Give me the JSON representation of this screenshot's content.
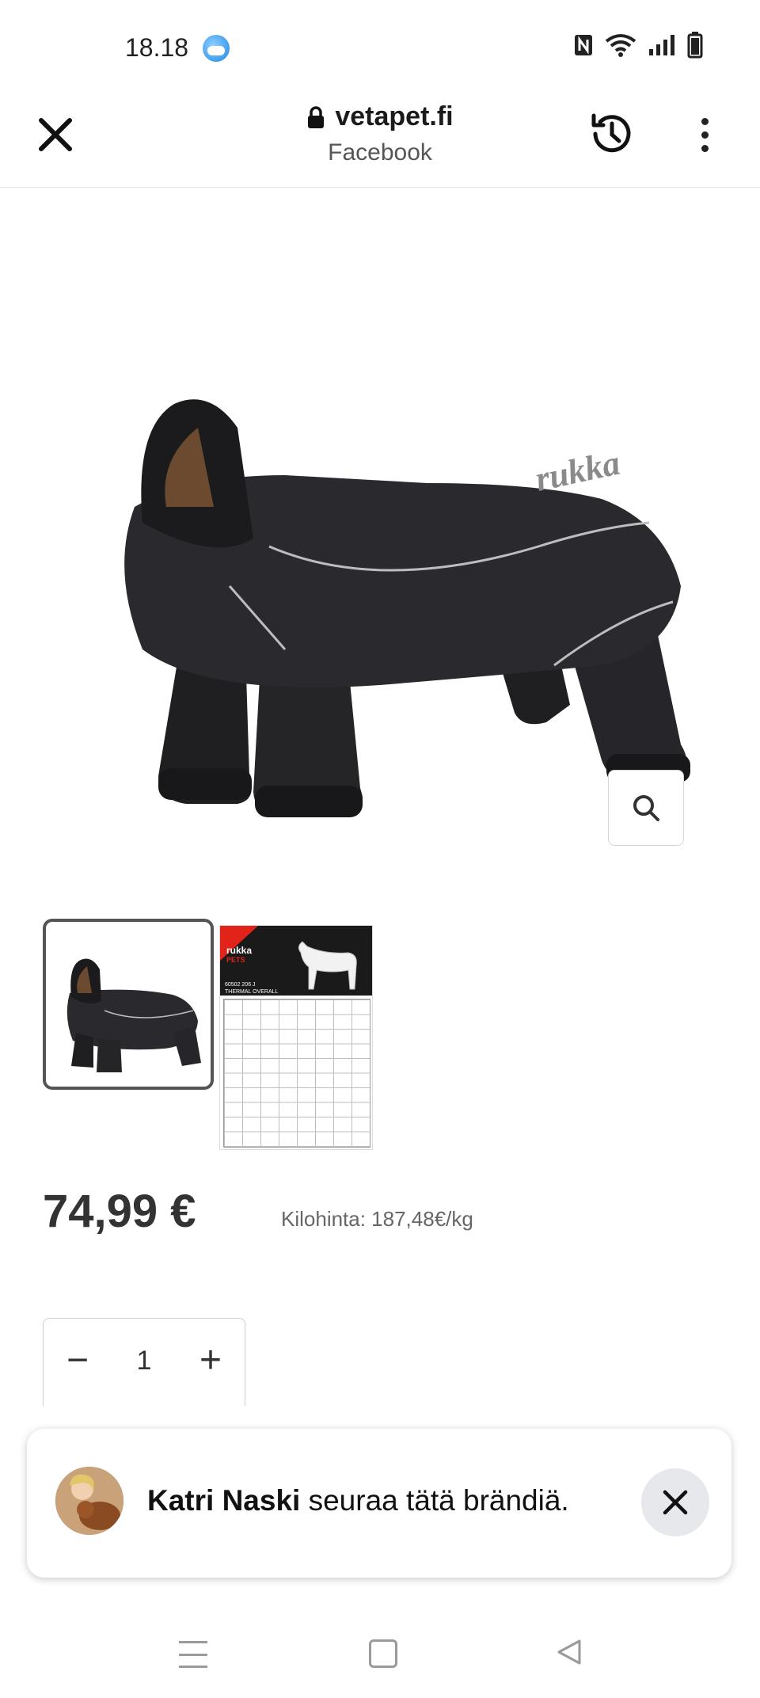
{
  "status_bar": {
    "time": "18.18",
    "icons": [
      "weather-icon",
      "nfc-icon",
      "wifi-icon",
      "signal-icon",
      "battery-icon"
    ]
  },
  "browser_header": {
    "domain": "vetapet.fi",
    "subtitle": "Facebook",
    "icons": [
      "close-icon",
      "lock-icon",
      "history-icon",
      "more-vert-icon"
    ]
  },
  "product": {
    "image_brand_text": "rukka",
    "price": "74,99 €",
    "unit_price": "Kilohinta: 187,48€/kg",
    "thumbnails": [
      {
        "label": "thumbnail-product-photo"
      },
      {
        "label": "thumbnail-size-chart",
        "brand": "rukka",
        "brand_sub": "PETS",
        "code": "60502 206 J",
        "title": "THERMAL OVERALL"
      }
    ]
  },
  "quantity": {
    "minus": "−",
    "value": "1",
    "plus": "+"
  },
  "toast": {
    "name": "Katri Naski",
    "message": " seuraa tätä brändiä."
  },
  "colors": {
    "accent_red": "#e2231a",
    "text_dark": "#222222",
    "text_gray": "#666666"
  }
}
